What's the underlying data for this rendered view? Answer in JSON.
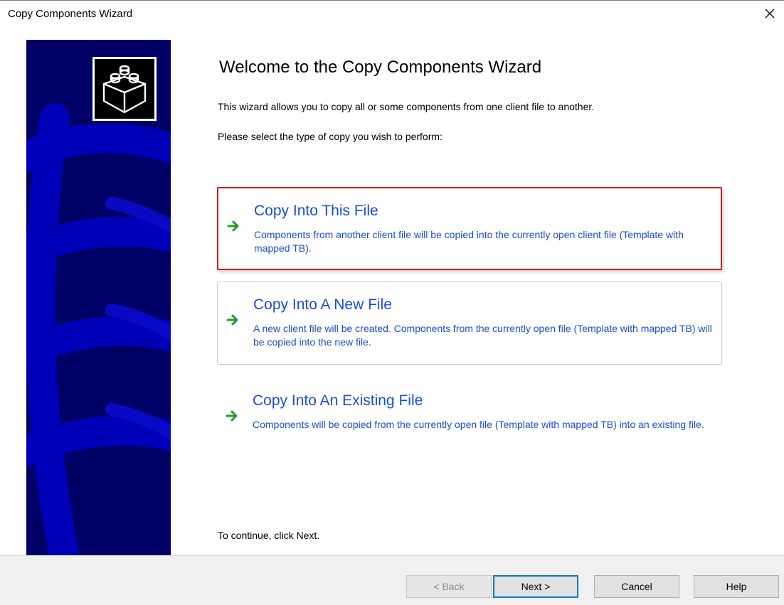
{
  "window": {
    "title": "Copy Components Wizard",
    "close_glyph": "✕"
  },
  "content": {
    "heading": "Welcome to the Copy Components Wizard",
    "intro_line1": "This wizard allows you to copy all or some components from one client file to another.",
    "intro_line2": "Please select the type of copy you wish to perform:",
    "continue_text": "To continue, click Next."
  },
  "options": [
    {
      "title": "Copy Into This File",
      "description": "Components from another client file will be copied into the currently open client file (Template with mapped TB).",
      "state": "selected"
    },
    {
      "title": "Copy Into A New File",
      "description": "A new client file will be created. Components from the currently open file (Template with mapped TB) will be copied into the new file.",
      "state": "hovered"
    },
    {
      "title": "Copy Into An Existing File",
      "description": "Components will be copied from the currently open file (Template with mapped TB) into an existing file.",
      "state": "normal"
    }
  ],
  "buttons": {
    "back": "< Back",
    "next": "Next >",
    "cancel": "Cancel",
    "help": "Help"
  },
  "colors": {
    "accent_text": "#1a4dd6",
    "arrow_green": "#1e9e2e",
    "panel_blue": "#000066",
    "selection_border": "#d61a1a"
  },
  "icons": {
    "logo": "lego-brick-icon",
    "option_arrow": "green-right-arrow-icon",
    "close": "close-icon"
  }
}
